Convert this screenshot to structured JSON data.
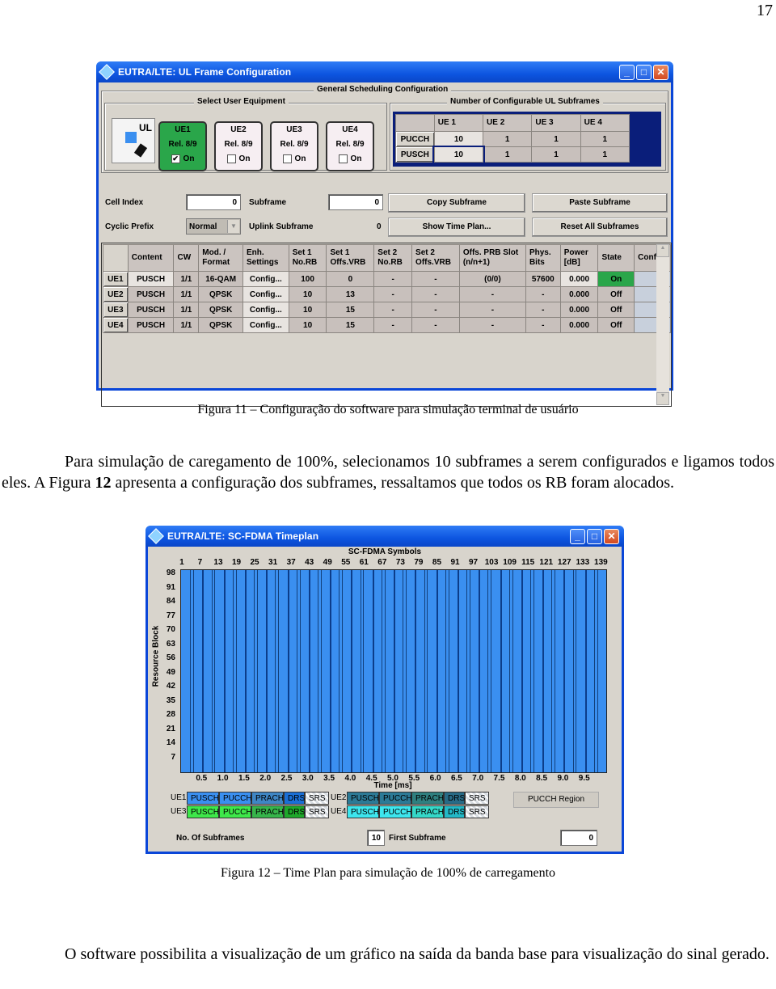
{
  "page_number": "17",
  "figure11": {
    "window_title": "EUTRA/LTE: UL Frame Configuration",
    "window_controls": [
      "minimize",
      "maximize",
      "close"
    ],
    "general_group_label": "General Scheduling Configuration",
    "select_ue_label": "Select User Equipment",
    "ue_cards": [
      {
        "name": "UE1",
        "release": "Rel. 8/9",
        "toggle_label": "On",
        "checked": true
      },
      {
        "name": "UE2",
        "release": "Rel. 8/9",
        "toggle_label": "On",
        "checked": false
      },
      {
        "name": "UE3",
        "release": "Rel. 8/9",
        "toggle_label": "On",
        "checked": false
      },
      {
        "name": "UE4",
        "release": "Rel. 8/9",
        "toggle_label": "On",
        "checked": false
      }
    ],
    "ul_icon_label": "UL",
    "subframes_group_label": "Number of Configurable UL Subframes",
    "subframes_table": {
      "columns": [
        "UE 1",
        "UE 2",
        "UE 3",
        "UE 4"
      ],
      "rows": [
        {
          "label": "PUCCH",
          "values": [
            "10",
            "1",
            "1",
            "1"
          ]
        },
        {
          "label": "PUSCH",
          "values": [
            "10",
            "1",
            "1",
            "1"
          ]
        }
      ]
    },
    "cell_index_label": "Cell Index",
    "cell_index_value": "0",
    "subframe_label": "Subframe",
    "subframe_value": "0",
    "cyclic_prefix_label": "Cyclic Prefix",
    "cyclic_prefix_value": "Normal",
    "uplink_subframe_label": "Uplink Subframe",
    "uplink_subframe_value": "0",
    "buttons": {
      "copy": "Copy Subframe",
      "paste": "Paste Subframe",
      "time_plan": "Show Time Plan...",
      "reset": "Reset All Subframes"
    },
    "config_table": {
      "headers": [
        "",
        "Content",
        "CW",
        "Mod. / Format",
        "Enh. Settings",
        "Set 1 No.RB",
        "Set 1 Offs.VRB",
        "Set 2 No.RB",
        "Set 2 Offs.VRB",
        "Offs. PRB Slot (n/n+1)",
        "Phys. Bits",
        "Power [dB]",
        "State",
        "Confl."
      ],
      "rows": [
        [
          "UE1",
          "PUSCH",
          "1/1",
          "16-QAM",
          "Config...",
          "100",
          "0",
          "-",
          "-",
          "(0/0)",
          "57600",
          "0.000",
          "On",
          ""
        ],
        [
          "UE2",
          "PUSCH",
          "1/1",
          "QPSK",
          "Config...",
          "10",
          "13",
          "-",
          "-",
          "-",
          "-",
          "0.000",
          "Off",
          ""
        ],
        [
          "UE3",
          "PUSCH",
          "1/1",
          "QPSK",
          "Config...",
          "10",
          "15",
          "-",
          "-",
          "-",
          "-",
          "0.000",
          "Off",
          ""
        ],
        [
          "UE4",
          "PUSCH",
          "1/1",
          "QPSK",
          "Config...",
          "10",
          "15",
          "-",
          "-",
          "-",
          "-",
          "0.000",
          "Off",
          ""
        ]
      ]
    },
    "caption": "Figura 11 – Configuração do software para simulação terminal de usuário"
  },
  "paragraph1": "Para simulação de caregamento de 100%, selecionamos 10 subframes a serem configurados e ligamos todos eles. A Figura 12 apresenta a configuração dos subframes, ressaltamos que todos os RB foram alocados.",
  "figure12": {
    "window_title": "EUTRA/LTE: SC-FDMA Timeplan",
    "top_axis_title": "SC-FDMA Symbols",
    "top_ticks": [
      "1",
      "7",
      "13",
      "19",
      "25",
      "31",
      "37",
      "43",
      "49",
      "55",
      "61",
      "67",
      "73",
      "79",
      "85",
      "91",
      "97",
      "103",
      "109",
      "115",
      "121",
      "127",
      "133",
      "139"
    ],
    "y_axis_title": "Resource Block",
    "y_ticks": [
      "98",
      "91",
      "84",
      "77",
      "70",
      "63",
      "56",
      "49",
      "42",
      "35",
      "28",
      "21",
      "14",
      "7"
    ],
    "x_axis_title": "Time [ms]",
    "x_ticks": [
      "0.5",
      "1.0",
      "1.5",
      "2.0",
      "2.5",
      "3.0",
      "3.5",
      "4.0",
      "4.5",
      "5.0",
      "5.5",
      "6.0",
      "6.5",
      "7.0",
      "7.5",
      "8.0",
      "8.5",
      "9.0",
      "9.5"
    ],
    "fill_color": "#3a8ff0",
    "allocated_fraction": 1.0,
    "legend": [
      {
        "ue": "UE1",
        "items": [
          [
            "PUSCH",
            "#3a8ff0"
          ],
          [
            "PUCCH",
            "#3a8ff0"
          ],
          [
            "PRACH",
            "#3f86c4"
          ],
          [
            "DRS",
            "#1a6fd6"
          ],
          [
            "SRS",
            "#d8dde2"
          ]
        ]
      },
      {
        "ue": "UE2",
        "items": [
          [
            "PUSCH",
            "#2c7a96"
          ],
          [
            "PUCCH",
            "#2c7a96"
          ],
          [
            "PRACH",
            "#2f7f7f"
          ],
          [
            "DRS",
            "#276a86"
          ],
          [
            "SRS",
            "#d8dde2"
          ]
        ]
      },
      {
        "ue": "UE3",
        "items": [
          [
            "PUSCH",
            "#3ee84a"
          ],
          [
            "PUCCH",
            "#3ee84a"
          ],
          [
            "PRACH",
            "#36b54a"
          ],
          [
            "DRS",
            "#1ea82a"
          ],
          [
            "SRS",
            "#d8dde2"
          ]
        ]
      },
      {
        "ue": "UE4",
        "items": [
          [
            "PUSCH",
            "#3de6ee"
          ],
          [
            "PUCCH",
            "#3de6ee"
          ],
          [
            "PRACH",
            "#34d8c8"
          ],
          [
            "DRS",
            "#22b8c6"
          ],
          [
            "SRS",
            "#d8dde2"
          ]
        ]
      }
    ],
    "pucch_region_label": "PUCCH Region",
    "no_subframes_label": "No. Of Subframes",
    "no_subframes_value": "10",
    "first_subframe_label": "First Subframe",
    "first_subframe_value": "0",
    "caption": "Figura 12 – Time Plan para simulação de 100% de carregamento"
  },
  "paragraph2": "O software possibilita a visualização de um gráfico na saída da banda base para visualização do sinal gerado."
}
